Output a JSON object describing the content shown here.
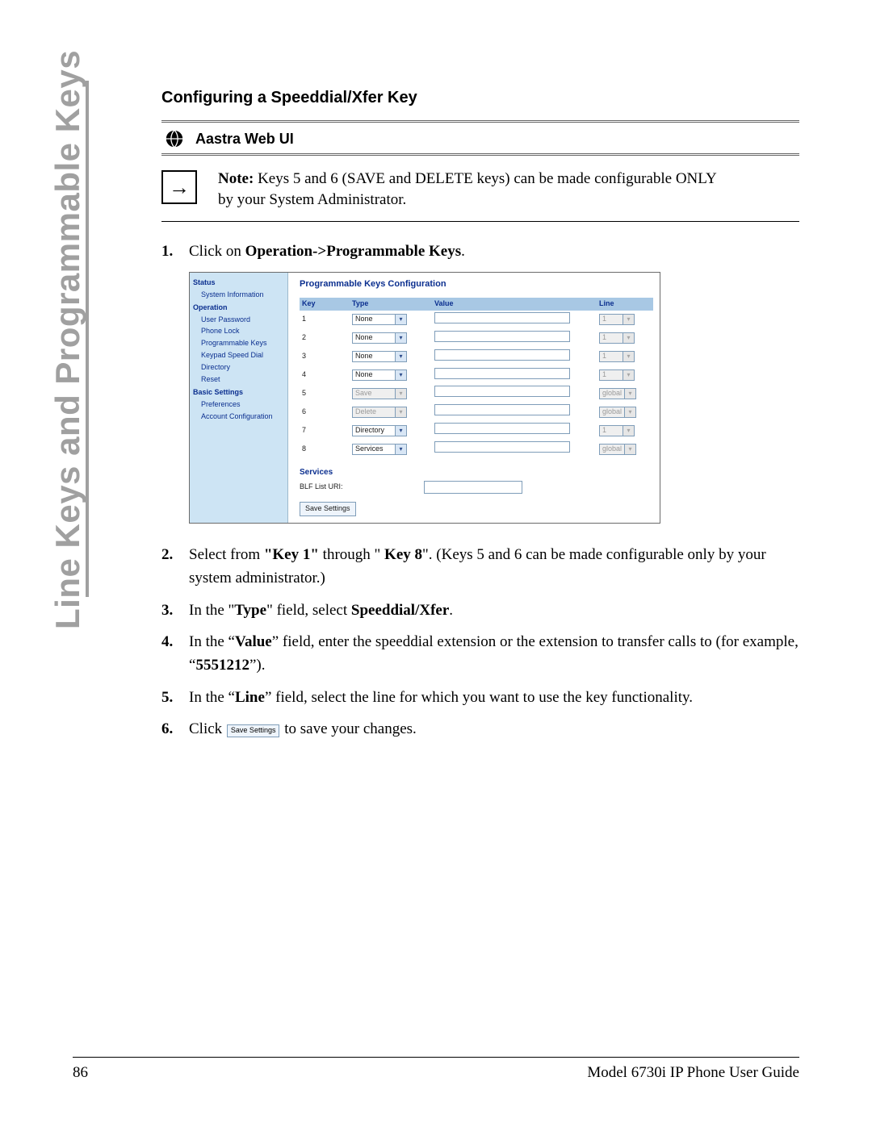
{
  "sideTab": "Line Keys and Programmable Keys",
  "heading": "Configuring a Speeddial/Xfer Key",
  "featureBarLabel": "Aastra Web UI",
  "note": {
    "prefix": "Note: ",
    "body": "Keys 5 and 6 (SAVE and DELETE keys) can be made configurable ONLY by your System Administrator."
  },
  "steps": [
    {
      "num": "1.",
      "pre": "Click on ",
      "bold1": "Operation->Programmable Keys",
      "post": "."
    },
    {
      "num": "2.",
      "t1": "Select from ",
      "b1": "\"Key 1\"",
      "t2": " through \"",
      "b2": "Key 8",
      "t3": "\". (Keys 5 and 6 can be made configurable only by your system administrator.)"
    },
    {
      "num": "3.",
      "t1": "In the \"",
      "b1": "Type",
      "t2": "\" field, select ",
      "b2": "Speeddial/Xfer",
      "t3": "."
    },
    {
      "num": "4.",
      "t1": "In the “",
      "b1": "Value",
      "t2": "” field, enter the speeddial extension or the extension to transfer calls to (for example, “",
      "b2": "5551212",
      "t3": "”)."
    },
    {
      "num": "5.",
      "t1": "In the “",
      "b1": "Line",
      "t2": "” field, select the line for which you want to use the key functionality."
    },
    {
      "num": "6.",
      "t1": "Click ",
      "btn": "Save Settings",
      "t2": " to save your changes."
    }
  ],
  "screenshot": {
    "title": "Programmable Keys Configuration",
    "nav": [
      {
        "label": "Status",
        "items": [
          "System Information"
        ]
      },
      {
        "label": "Operation",
        "items": [
          "User Password",
          "Phone Lock",
          "Programmable Keys",
          "Keypad Speed Dial",
          "Directory",
          "Reset"
        ]
      },
      {
        "label": "Basic Settings",
        "items": [
          "Preferences",
          "Account Configuration"
        ]
      }
    ],
    "columns": [
      "Key",
      "Type",
      "Value",
      "Line"
    ],
    "rows": [
      {
        "key": "1",
        "type": "None",
        "line": "1"
      },
      {
        "key": "2",
        "type": "None",
        "line": "1"
      },
      {
        "key": "3",
        "type": "None",
        "line": "1"
      },
      {
        "key": "4",
        "type": "None",
        "line": "1"
      },
      {
        "key": "5",
        "type": "Save",
        "line": "global"
      },
      {
        "key": "6",
        "type": "Delete",
        "line": "global"
      },
      {
        "key": "7",
        "type": "Directory",
        "line": "1"
      },
      {
        "key": "8",
        "type": "Services",
        "line": "global"
      }
    ],
    "servicesLabel": "Services",
    "blfLabel": "BLF List URI:",
    "saveBtn": "Save Settings"
  },
  "footer": {
    "page": "86",
    "title": "Model 6730i IP Phone User Guide"
  }
}
